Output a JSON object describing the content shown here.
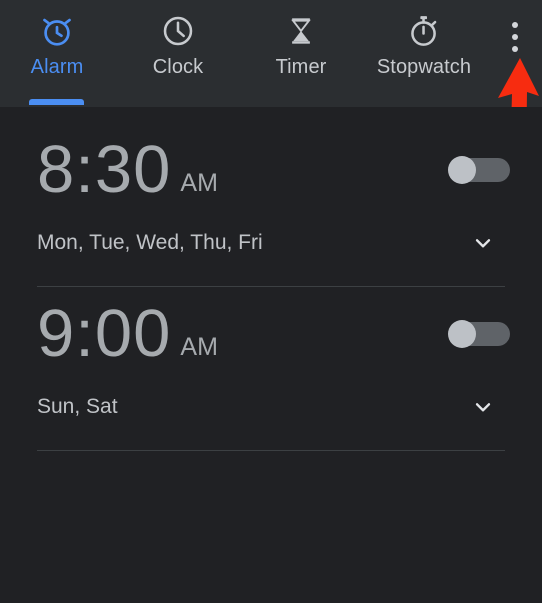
{
  "app": {
    "background_color": "#202124",
    "tabbar_background_color": "#2b2e31",
    "accent_color": "#4b8ef2",
    "annotation_color": "#f72c10"
  },
  "tabs": [
    {
      "id": "alarm",
      "label": "Alarm",
      "icon": "alarm-clock-icon",
      "active": true
    },
    {
      "id": "clock",
      "label": "Clock",
      "icon": "clock-icon",
      "active": false
    },
    {
      "id": "timer",
      "label": "Timer",
      "icon": "hourglass-icon",
      "active": false
    },
    {
      "id": "stopwatch",
      "label": "Stopwatch",
      "icon": "stopwatch-icon",
      "active": false
    }
  ],
  "overflow_menu": {
    "icon": "more-vertical-icon",
    "label": "More options"
  },
  "annotation": {
    "icon": "red-arrow-up-icon",
    "points_to": "overflow-menu",
    "color": "#f72c10"
  },
  "alarms": [
    {
      "time": "8:30",
      "meridiem": "AM",
      "days": "Mon, Tue, Wed, Thu, Fri",
      "enabled": false,
      "expand_icon": "chevron-down-icon"
    },
    {
      "time": "9:00",
      "meridiem": "AM",
      "days": "Sun, Sat",
      "enabled": false,
      "expand_icon": "chevron-down-icon"
    }
  ]
}
